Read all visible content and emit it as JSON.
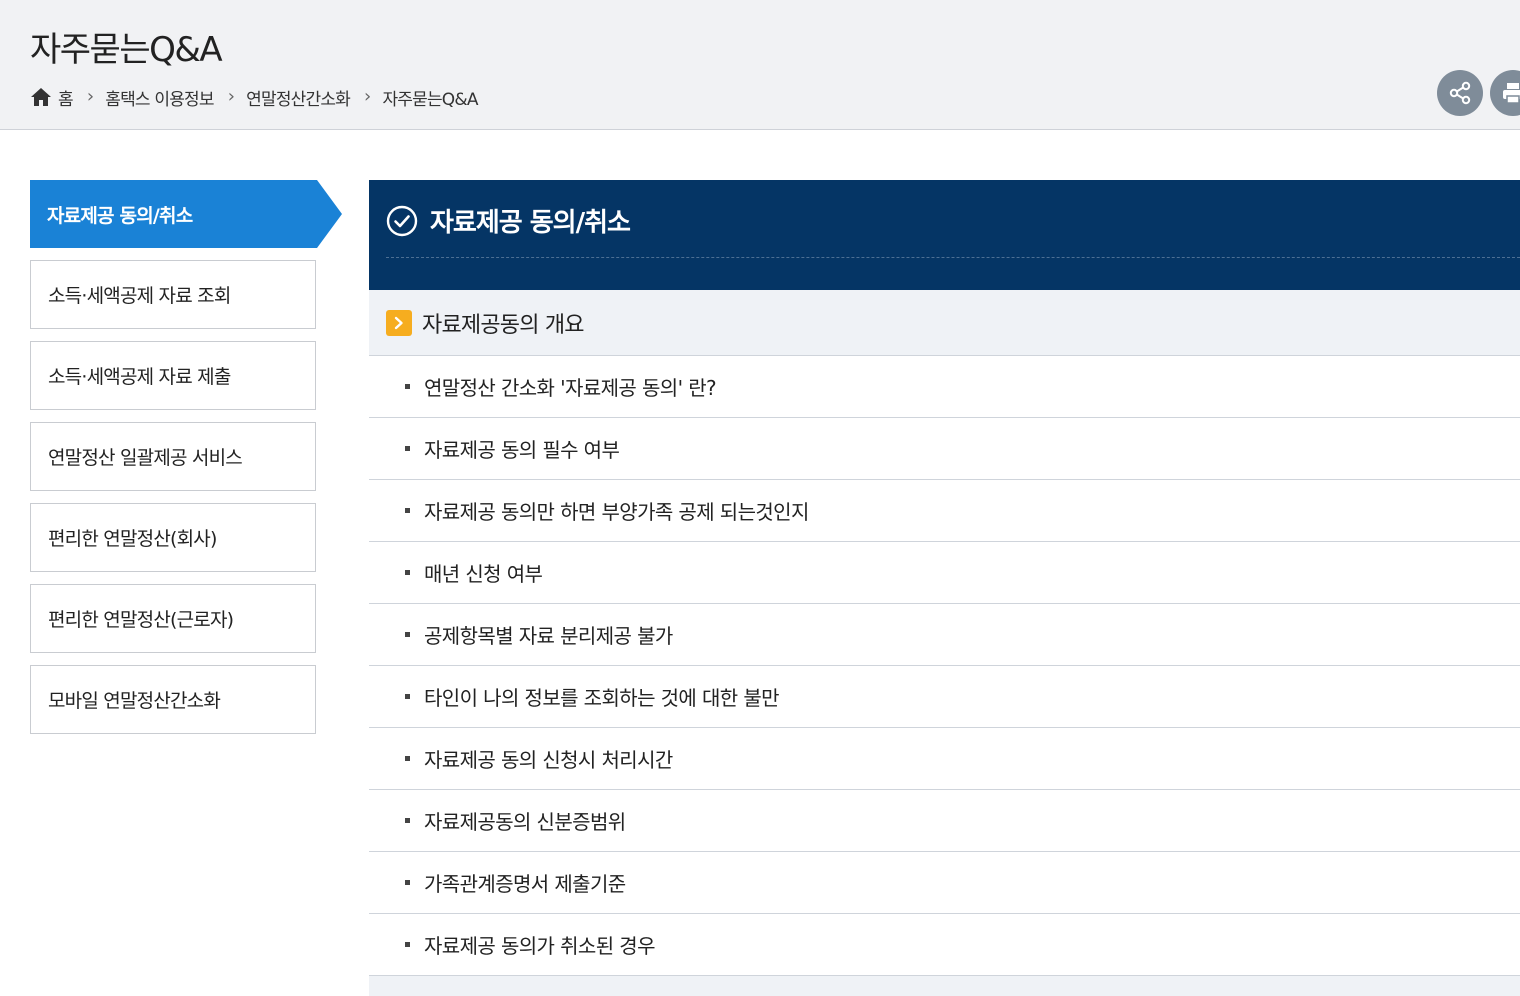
{
  "page": {
    "title": "자주묻는Q&A"
  },
  "breadcrumb": {
    "items": [
      "홈",
      "홈택스 이용정보",
      "연말정산간소화",
      "자주묻는Q&A"
    ]
  },
  "toolbar": {
    "share_icon": "share-icon",
    "print_icon": "print-icon"
  },
  "side_menu": {
    "active": "자료제공 동의/취소",
    "items": [
      "소득·세액공제 자료 조회",
      "소득·세액공제 자료 제출",
      "연말정산 일괄제공 서비스",
      "편리한 연말정산(회사)",
      "편리한 연말정산(근로자)",
      "모바일 연말정산간소화"
    ]
  },
  "content": {
    "title": "자료제공 동의/취소",
    "section_title": "자료제공동의 개요",
    "questions": [
      "연말정산 간소화 '자료제공 동의' 란?",
      "자료제공 동의 필수 여부",
      "자료제공 동의만 하면 부양가족 공제 되는것인지",
      "매년 신청 여부",
      "공제항목별 자료 분리제공 불가",
      "타인이 나의 정보를 조회하는 것에 대한 불만",
      "자료제공 동의 신청시 처리시간",
      "자료제공동의 신분증범위",
      "가족관계증명서 제출기준",
      "자료제공 동의가 취소된 경우"
    ]
  },
  "colors": {
    "header_bg": "#f1f2f4",
    "menu_active": "#1a82d6",
    "content_header": "#053565",
    "section_bg": "#eff2f6",
    "section_arrow": "#f6ad1f",
    "tool_button": "#7f8c99"
  }
}
